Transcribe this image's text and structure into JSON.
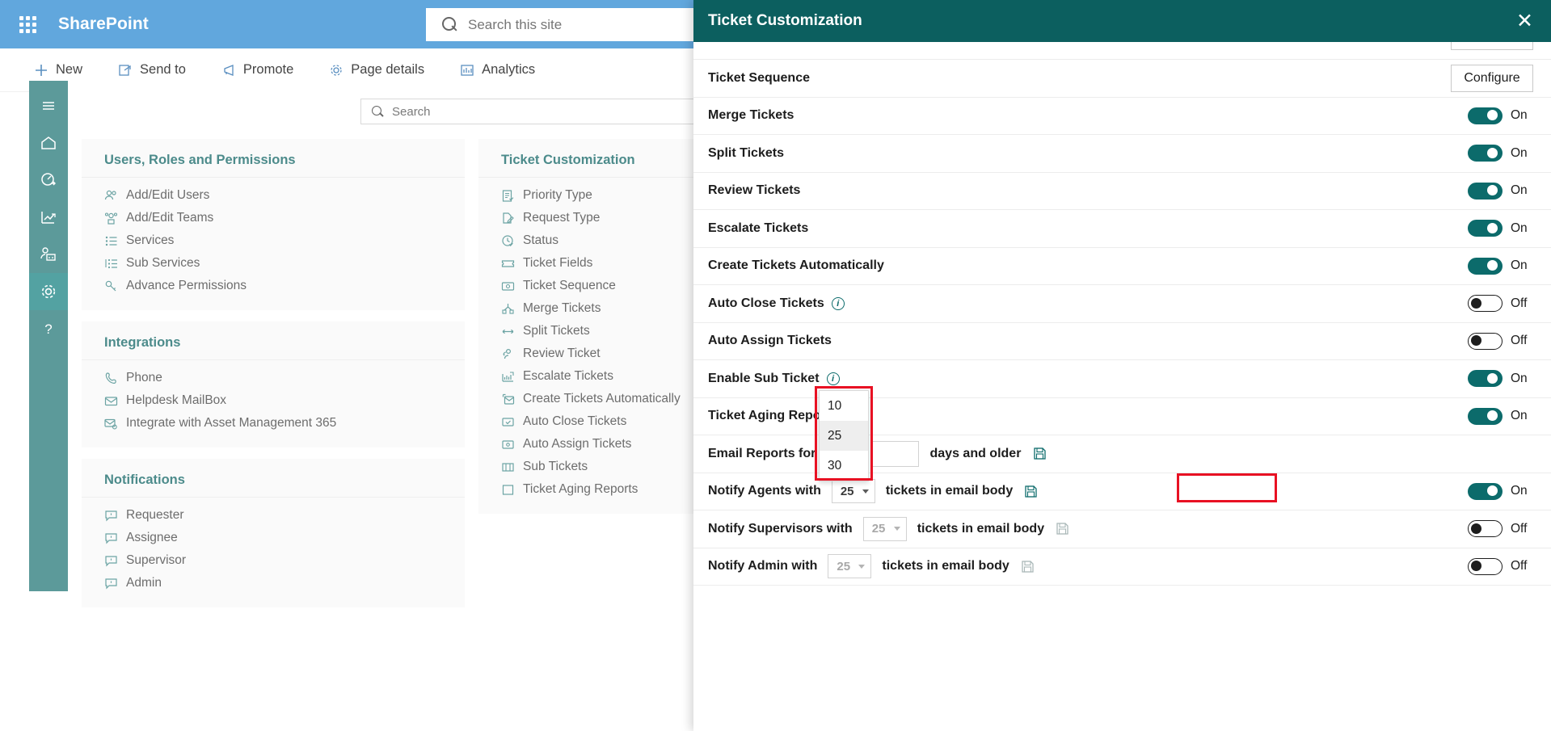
{
  "suite": {
    "brand": "SharePoint",
    "waffle_icon": "app-launcher-icon",
    "search_placeholder": "Search this site",
    "search_value": "",
    "search_icon": "search-icon"
  },
  "commandbar": {
    "items": [
      {
        "label": "New",
        "icon": "plus-icon"
      },
      {
        "label": "Send to",
        "icon": "send-to-icon"
      },
      {
        "label": "Promote",
        "icon": "promote-megaphone-icon"
      },
      {
        "label": "Page details",
        "icon": "gear-icon"
      },
      {
        "label": "Analytics",
        "icon": "analytics-bar-chart-icon"
      }
    ]
  },
  "rail": {
    "items": [
      {
        "icon": "hamburger-menu-icon",
        "name": "menu"
      },
      {
        "icon": "home-icon",
        "name": "home"
      },
      {
        "icon": "dashboard-gauge-icon",
        "name": "dashboard"
      },
      {
        "icon": "report-chart-icon",
        "name": "reports"
      },
      {
        "icon": "agent-board-icon",
        "name": "agents"
      },
      {
        "icon": "gear-icon",
        "name": "settings",
        "active": true
      },
      {
        "icon": "help-question-icon",
        "name": "help"
      }
    ]
  },
  "page_search": {
    "placeholder": "Search",
    "value": "",
    "icon": "search-icon"
  },
  "cards": [
    {
      "title": "Users, Roles and Permissions",
      "items": [
        {
          "label": "Add/Edit Users",
          "icon": "users-icon"
        },
        {
          "label": "Add/Edit Teams",
          "icon": "teams-icon"
        },
        {
          "label": "Services",
          "icon": "list-icon"
        },
        {
          "label": "Sub Services",
          "icon": "sub-list-icon"
        },
        {
          "label": "Advance Permissions",
          "icon": "key-icon"
        }
      ]
    },
    {
      "title": "Integrations",
      "items": [
        {
          "label": "Phone",
          "icon": "phone-icon"
        },
        {
          "label": "Helpdesk MailBox",
          "icon": "mail-icon"
        },
        {
          "label": "Integrate with Asset Management 365",
          "icon": "mail-gear-icon"
        }
      ]
    },
    {
      "title": "Notifications",
      "items": [
        {
          "label": "Requester",
          "icon": "comment-alert-icon"
        },
        {
          "label": "Assignee",
          "icon": "comment-alert-icon"
        },
        {
          "label": "Supervisor",
          "icon": "comment-alert-icon"
        },
        {
          "label": "Admin",
          "icon": "comment-alert-icon"
        }
      ]
    },
    {
      "title": "Ticket Customization",
      "items": [
        {
          "label": "Priority Type",
          "icon": "priority-list-icon"
        },
        {
          "label": "Request Type",
          "icon": "request-edit-icon"
        },
        {
          "label": "Status",
          "icon": "clock-check-icon"
        },
        {
          "label": "Ticket Fields",
          "icon": "ticket-icon"
        },
        {
          "label": "Ticket Sequence",
          "icon": "sequence-icon"
        },
        {
          "label": "Merge Tickets",
          "icon": "merge-icon"
        },
        {
          "label": "Split Tickets",
          "icon": "split-arrows-icon"
        },
        {
          "label": "Review Ticket",
          "icon": "review-people-icon"
        },
        {
          "label": "Escalate Tickets",
          "icon": "escalate-chart-icon"
        },
        {
          "label": "Create Tickets Automatically",
          "icon": "create-mail-icon"
        },
        {
          "label": "Auto Close Tickets",
          "icon": "auto-close-icon"
        },
        {
          "label": "Auto Assign Tickets",
          "icon": "auto-assign-icon"
        },
        {
          "label": "Sub Tickets",
          "icon": "sub-ticket-icon"
        },
        {
          "label": "Ticket Aging Reports",
          "icon": "aging-report-icon"
        }
      ]
    }
  ],
  "panel": {
    "title": "Ticket Customization",
    "close_icon": "close-icon",
    "rows": [
      {
        "type": "partial",
        "label": "",
        "control": "button",
        "button_label": ""
      },
      {
        "type": "button",
        "label": "Ticket Sequence",
        "button_label": "Configure"
      },
      {
        "type": "toggle",
        "label": "Merge Tickets",
        "state": "On",
        "on": true
      },
      {
        "type": "toggle",
        "label": "Split Tickets",
        "state": "On",
        "on": true
      },
      {
        "type": "toggle",
        "label": "Review Tickets",
        "state": "On",
        "on": true
      },
      {
        "type": "toggle",
        "label": "Escalate Tickets",
        "state": "On",
        "on": true
      },
      {
        "type": "toggle",
        "label": "Create Tickets Automatically",
        "state": "On",
        "on": true
      },
      {
        "type": "toggle",
        "label": "Auto Close Tickets",
        "state": "Off",
        "on": false,
        "info": true
      },
      {
        "type": "toggle",
        "label": "Auto Assign Tickets",
        "state": "Off",
        "on": false
      },
      {
        "type": "toggle",
        "label": "Enable Sub Ticket",
        "state": "On",
        "on": true,
        "info": true
      },
      {
        "type": "toggle",
        "label": "Ticket Aging Report",
        "state": "On",
        "on": true
      },
      {
        "type": "email-reports",
        "label": "Email Reports for tickets",
        "suffix": "days and older",
        "value": "",
        "save_icon": "save-icon"
      },
      {
        "type": "notify",
        "label": "Notify Agents with",
        "select_value": "25",
        "suffix": "tickets in email body",
        "state": "On",
        "on": true,
        "disabled": false,
        "save_icon": "save-icon",
        "highlighted": true
      },
      {
        "type": "notify",
        "label": "Notify Supervisors with",
        "select_value": "25",
        "suffix": "tickets in email body",
        "state": "Off",
        "on": false,
        "disabled": true,
        "save_icon": "save-icon"
      },
      {
        "type": "notify",
        "label": "Notify Admin with",
        "select_value": "25",
        "suffix": "tickets in email body",
        "state": "Off",
        "on": false,
        "disabled": true,
        "save_icon": "save-icon"
      }
    ],
    "open_dropdown": {
      "options": [
        "10",
        "25",
        "30"
      ],
      "highlighted": "25"
    },
    "accent_color": "#0c5f5f",
    "highlight_color": "#e81123"
  }
}
